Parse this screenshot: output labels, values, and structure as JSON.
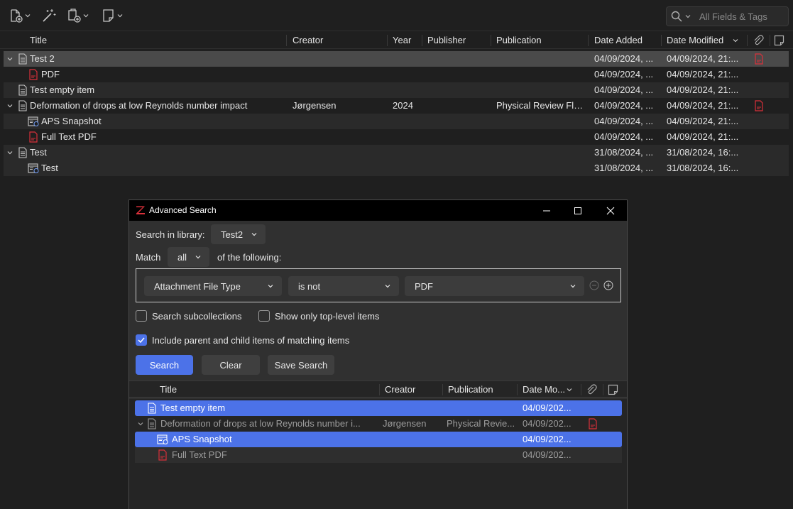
{
  "toolbar": {
    "buttons": [
      "new-item",
      "add-by-identifier",
      "new-attachment",
      "new-note"
    ],
    "search_placeholder": "All Fields & Tags"
  },
  "main_table": {
    "columns": [
      "Title",
      "Creator",
      "Year",
      "Publisher",
      "Publication",
      "Date Added",
      "Date Modified"
    ],
    "rows": [
      {
        "title": "Test 2",
        "creator": "",
        "year": "",
        "publication": "",
        "added": "04/09/2024, ...",
        "modified": "04/09/2024, 21:...",
        "pdf": true
      },
      {
        "title": "PDF",
        "creator": "",
        "year": "",
        "publication": "",
        "added": "04/09/2024, ...",
        "modified": "04/09/2024, 21:...",
        "pdf": false
      },
      {
        "title": "Test empty item",
        "creator": "",
        "year": "",
        "publication": "",
        "added": "04/09/2024, ...",
        "modified": "04/09/2024, 21:...",
        "pdf": false
      },
      {
        "title": "Deformation of drops at low Reynolds number impact",
        "creator": "Jørgensen",
        "year": "2024",
        "publication": "Physical Review Flui...",
        "added": "04/09/2024, ...",
        "modified": "04/09/2024, 21:...",
        "pdf": true
      },
      {
        "title": "APS Snapshot",
        "creator": "",
        "year": "",
        "publication": "",
        "added": "04/09/2024, ...",
        "modified": "04/09/2024, 21:...",
        "pdf": false
      },
      {
        "title": "Full Text PDF",
        "creator": "",
        "year": "",
        "publication": "",
        "added": "04/09/2024, ...",
        "modified": "04/09/2024, 21:...",
        "pdf": false
      },
      {
        "title": "Test",
        "creator": "",
        "year": "",
        "publication": "",
        "added": "31/08/2024, ...",
        "modified": "31/08/2024, 16:...",
        "pdf": false
      },
      {
        "title": "Test",
        "creator": "",
        "year": "",
        "publication": "",
        "added": "31/08/2024, ...",
        "modified": "31/08/2024, 16:...",
        "pdf": false
      }
    ]
  },
  "dialog": {
    "title": "Advanced Search",
    "search_in_label": "Search in library:",
    "library": "Test2",
    "match_label": "Match",
    "match_value": "all",
    "following_label": "of the following:",
    "condition": {
      "field": "Attachment File Type",
      "operator": "is not",
      "value": "PDF"
    },
    "search_subcollections": "Search subcollections",
    "top_level_only": "Show only top-level items",
    "include_parent_child": "Include parent and child items of matching items",
    "include_checked": true,
    "buttons": {
      "search": "Search",
      "clear": "Clear",
      "save": "Save Search"
    },
    "results": {
      "columns": [
        "Title",
        "Creator",
        "Publication",
        "Date Mo..."
      ],
      "rows": [
        {
          "title": "Test empty item",
          "creator": "",
          "publication": "",
          "modified": "04/09/202..."
        },
        {
          "title": "Deformation of drops at low Reynolds number i...",
          "creator": "Jørgensen",
          "publication": "Physical Revie...",
          "modified": "04/09/202..."
        },
        {
          "title": "APS Snapshot",
          "creator": "",
          "publication": "",
          "modified": "04/09/202..."
        },
        {
          "title": "Full Text PDF",
          "creator": "",
          "publication": "",
          "modified": "04/09/202..."
        }
      ]
    }
  },
  "colors": {
    "accent": "#4c72e8",
    "background": "#1f1f1f",
    "dialog": "#303030",
    "pdf_red": "#d9303a"
  }
}
